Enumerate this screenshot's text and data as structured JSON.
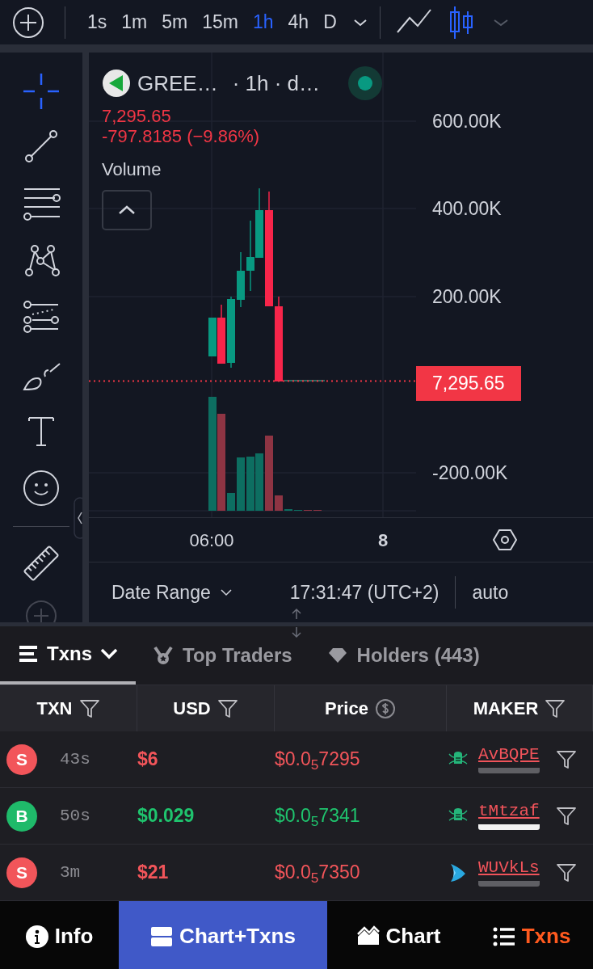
{
  "toolbar": {
    "intervals": [
      {
        "label": "1s",
        "selected": false
      },
      {
        "label": "1m",
        "selected": false
      },
      {
        "label": "5m",
        "selected": false
      },
      {
        "label": "15m",
        "selected": false
      },
      {
        "label": "1h",
        "selected": true
      },
      {
        "label": "4h",
        "selected": false
      },
      {
        "label": "D",
        "selected": false
      }
    ],
    "chart_styles": [
      {
        "kind": "line",
        "selected": false
      },
      {
        "kind": "candles",
        "selected": true
      }
    ]
  },
  "drawing_tools": [
    {
      "kind": "crosshair",
      "selected": true
    },
    {
      "kind": "trend-line",
      "selected": false
    },
    {
      "kind": "lines",
      "selected": false
    },
    {
      "kind": "pattern",
      "selected": false
    },
    {
      "kind": "fib",
      "selected": false
    },
    {
      "kind": "brush",
      "selected": false
    },
    {
      "kind": "text",
      "selected": false
    },
    {
      "kind": "emoji",
      "selected": false
    },
    {
      "kind": "ruler",
      "selected": false
    },
    {
      "kind": "zoom",
      "selected": false
    }
  ],
  "legend": {
    "symbol": "GREE…",
    "details": "· 1h · d…",
    "price": "7,295.65",
    "change": "-797.8185 (−9.86%)",
    "study": "Volume"
  },
  "price_axis": [
    "600.00K",
    "400.00K",
    "200.00K",
    "-200.00K"
  ],
  "last_price": "7,295.65",
  "time_axis": [
    {
      "label": "06:00",
      "kind": "time"
    },
    {
      "label": "8",
      "kind": "day"
    }
  ],
  "footer": {
    "date_range": "Date Range",
    "clock": "17:31:47 (UTC+2)",
    "scale": "auto"
  },
  "tabs": [
    {
      "label": "Txns",
      "kind": "list",
      "selected": true
    },
    {
      "label": "Top Traders",
      "kind": "medal",
      "selected": false
    },
    {
      "label": "Holders (443)",
      "kind": "diamond",
      "selected": false
    }
  ],
  "columns": [
    {
      "label": "TXN",
      "kind": "filter"
    },
    {
      "label": "USD",
      "kind": "filter"
    },
    {
      "label": "Price",
      "kind": "currency"
    },
    {
      "label": "MAKER",
      "kind": "filter"
    }
  ],
  "rows": [
    {
      "side": "S",
      "kind": "sell",
      "age": "43s",
      "usd": "$6",
      "price": "$0.0$_{5}$7295",
      "maker": {
        "name": "AvBQPE",
        "kind": "bug",
        "color": "#5f5f64"
      }
    },
    {
      "side": "B",
      "kind": "buy",
      "age": "50s",
      "usd": "$0.029",
      "price": "$0.0$_{5}$7341",
      "maker": {
        "name": "tMtzaf",
        "kind": "bug",
        "color": "#f2f2f2"
      }
    },
    {
      "side": "S",
      "kind": "sell",
      "age": "3m",
      "usd": "$21",
      "price": "$0.0$_{5}$7350",
      "maker": {
        "name": "WUVkLs",
        "kind": "fish",
        "color": "#5f5f64"
      }
    }
  ],
  "bottom_nav": [
    {
      "label": "Info",
      "kind": "info",
      "selected": false,
      "accent": false
    },
    {
      "label": "Chart+Txns",
      "kind": "split",
      "selected": true,
      "accent": false
    },
    {
      "label": "Chart",
      "kind": "chart",
      "selected": false,
      "accent": false
    },
    {
      "label": "Txns",
      "kind": "list",
      "selected": false,
      "accent": true
    }
  ]
}
